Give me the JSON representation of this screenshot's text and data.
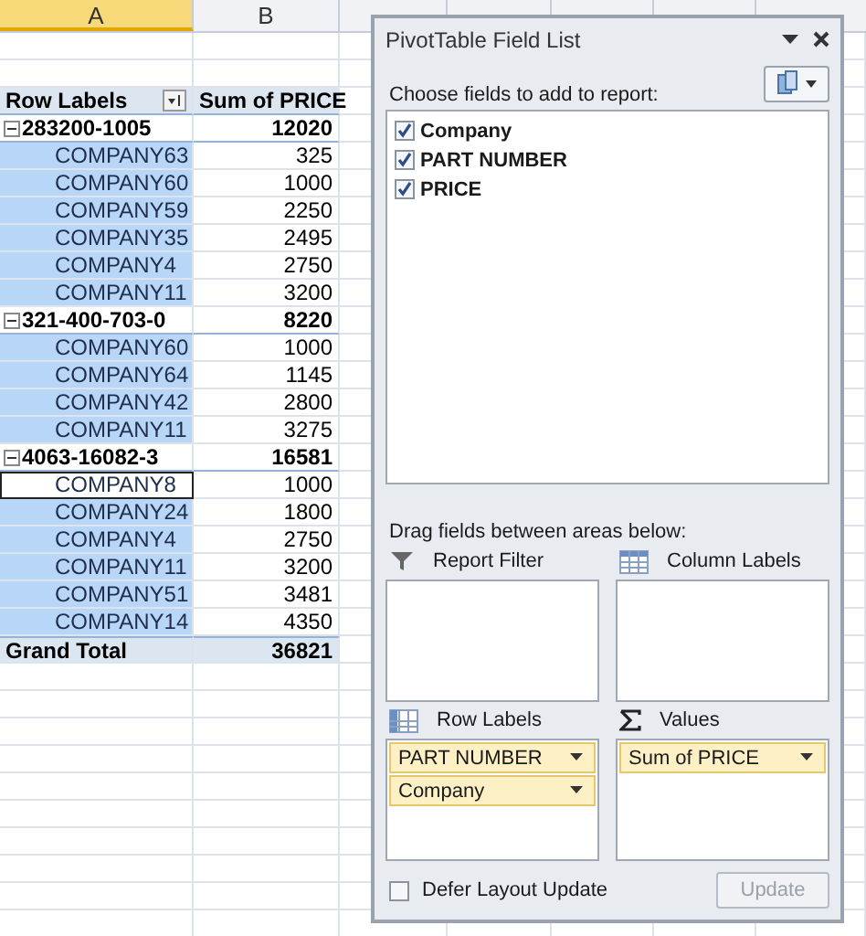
{
  "columns": [
    {
      "label": "A",
      "selected": true
    },
    {
      "label": "B",
      "selected": false
    }
  ],
  "pivot": {
    "header": {
      "row_labels": "Row Labels",
      "values": "Sum of PRICE"
    },
    "groups": [
      {
        "label": "283200-1005",
        "total": "12020",
        "expanded": true,
        "rows": [
          {
            "label": "COMPANY63",
            "value": "325",
            "selected": true,
            "active": false
          },
          {
            "label": "COMPANY60",
            "value": "1000",
            "selected": true,
            "active": false
          },
          {
            "label": "COMPANY59",
            "value": "2250",
            "selected": true,
            "active": false
          },
          {
            "label": "COMPANY35",
            "value": "2495",
            "selected": true,
            "active": false
          },
          {
            "label": "COMPANY4",
            "value": "2750",
            "selected": true,
            "active": false
          },
          {
            "label": "COMPANY11",
            "value": "3200",
            "selected": true,
            "active": false
          }
        ]
      },
      {
        "label": "321-400-703-0",
        "total": "8220",
        "expanded": true,
        "rows": [
          {
            "label": "COMPANY60",
            "value": "1000",
            "selected": true,
            "active": false
          },
          {
            "label": "COMPANY64",
            "value": "1145",
            "selected": true,
            "active": false
          },
          {
            "label": "COMPANY42",
            "value": "2800",
            "selected": true,
            "active": false
          },
          {
            "label": "COMPANY11",
            "value": "3275",
            "selected": true,
            "active": false
          }
        ]
      },
      {
        "label": "4063-16082-3",
        "total": "16581",
        "expanded": true,
        "rows": [
          {
            "label": "COMPANY8",
            "value": "1000",
            "selected": true,
            "active": true
          },
          {
            "label": "COMPANY24",
            "value": "1800",
            "selected": true,
            "active": false
          },
          {
            "label": "COMPANY4",
            "value": "2750",
            "selected": true,
            "active": false
          },
          {
            "label": "COMPANY11",
            "value": "3200",
            "selected": true,
            "active": false
          },
          {
            "label": "COMPANY51",
            "value": "3481",
            "selected": true,
            "active": false
          },
          {
            "label": "COMPANY14",
            "value": "4350",
            "selected": true,
            "active": false
          }
        ]
      }
    ],
    "grand_total": {
      "label": "Grand Total",
      "value": "36821"
    }
  },
  "panel": {
    "title": "PivotTable Field List",
    "choose_label": "Choose fields to add to report:",
    "fields": [
      {
        "label": "Company",
        "checked": true
      },
      {
        "label": "PART NUMBER",
        "checked": true
      },
      {
        "label": "PRICE",
        "checked": true
      }
    ],
    "drag_label": "Drag fields between areas below:",
    "areas": [
      {
        "kind": "filter",
        "label": "Report Filter"
      },
      {
        "kind": "columns",
        "label": "Column Labels"
      },
      {
        "kind": "rows",
        "label": "Row Labels",
        "items": [
          "PART NUMBER",
          "Company"
        ]
      },
      {
        "kind": "values",
        "label": "Values",
        "items": [
          "Sum of PRICE"
        ]
      }
    ],
    "defer": {
      "label": "Defer Layout Update",
      "checked": false
    },
    "update": {
      "label": "Update",
      "disabled": true
    }
  }
}
